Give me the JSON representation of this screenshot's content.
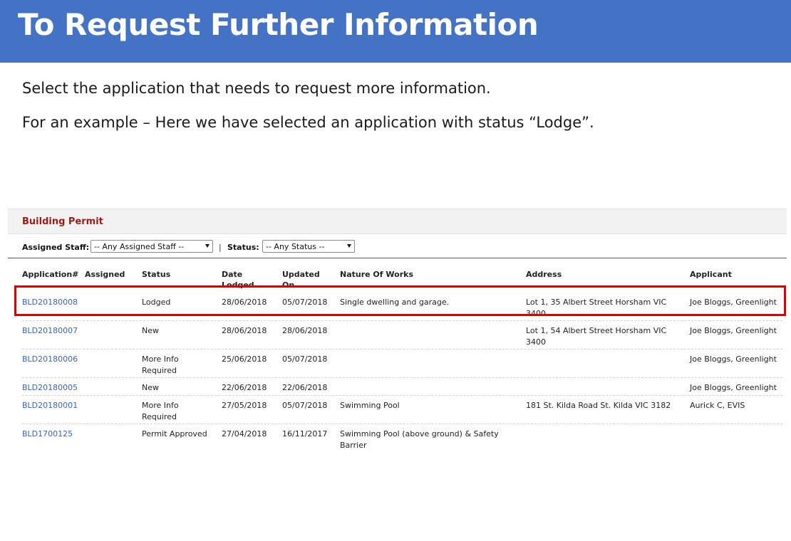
{
  "slide": {
    "title": "To Request Further Information",
    "instructions": [
      "Select the application that needs to request more information.",
      "For an example – Here we have selected an application with status “Lodge”."
    ]
  },
  "panel": {
    "title": "Building Permit",
    "filters": {
      "assigned_staff_label": "Assigned Staff:",
      "assigned_staff_value": "-- Any Assigned Staff --",
      "separator": "|",
      "status_label": "Status:",
      "status_value": "-- Any Status --"
    }
  },
  "table": {
    "columns": {
      "application": "Application#",
      "assigned": "Assigned",
      "status": "Status",
      "date_lodged": "Date Lodged",
      "updated_on": "Updated On",
      "nature_of_works": "Nature Of Works",
      "address": "Address",
      "applicant": "Applicant"
    },
    "rows": [
      {
        "application": "BLD20180008",
        "assigned": "",
        "status": "Lodged",
        "date_lodged": "28/06/2018",
        "updated_on": "05/07/2018",
        "nature_of_works": "Single dwelling and garage.",
        "address": "Lot 1, 35 Albert Street Horsham VIC 3400",
        "applicant": "Joe Bloggs, Greenlight"
      },
      {
        "application": "BLD20180007",
        "assigned": "",
        "status": "New",
        "date_lodged": "28/06/2018",
        "updated_on": "28/06/2018",
        "nature_of_works": "",
        "address": "Lot 1, 54 Albert Street Horsham VIC 3400",
        "applicant": "Joe Bloggs, Greenlight"
      },
      {
        "application": "BLD20180006",
        "assigned": "",
        "status": "More Info Required",
        "date_lodged": "25/06/2018",
        "updated_on": "05/07/2018",
        "nature_of_works": "",
        "address": "",
        "applicant": "Joe Bloggs, Greenlight"
      },
      {
        "application": "BLD20180005",
        "assigned": "",
        "status": "New",
        "date_lodged": "22/06/2018",
        "updated_on": "22/06/2018",
        "nature_of_works": "",
        "address": "",
        "applicant": "Joe Bloggs, Greenlight"
      },
      {
        "application": "BLD20180001",
        "assigned": "",
        "status": "More Info Required",
        "date_lodged": "27/05/2018",
        "updated_on": "05/07/2018",
        "nature_of_works": "Swimming Pool",
        "address": "181 St. Kilda Road St. Kilda VIC 3182",
        "applicant": "Aurick C, EVIS"
      },
      {
        "application": "BLD1700125",
        "assigned": "",
        "status": "Permit Approved",
        "date_lodged": "27/04/2018",
        "updated_on": "16/11/2017",
        "nature_of_works": "Swimming Pool (above ground) & Safety Barrier",
        "address": "",
        "applicant": ""
      }
    ]
  },
  "colors": {
    "title_bar": "#4472c4",
    "panel_title": "#9a1c14",
    "link": "#3a63c9",
    "highlight": "#e00000"
  }
}
